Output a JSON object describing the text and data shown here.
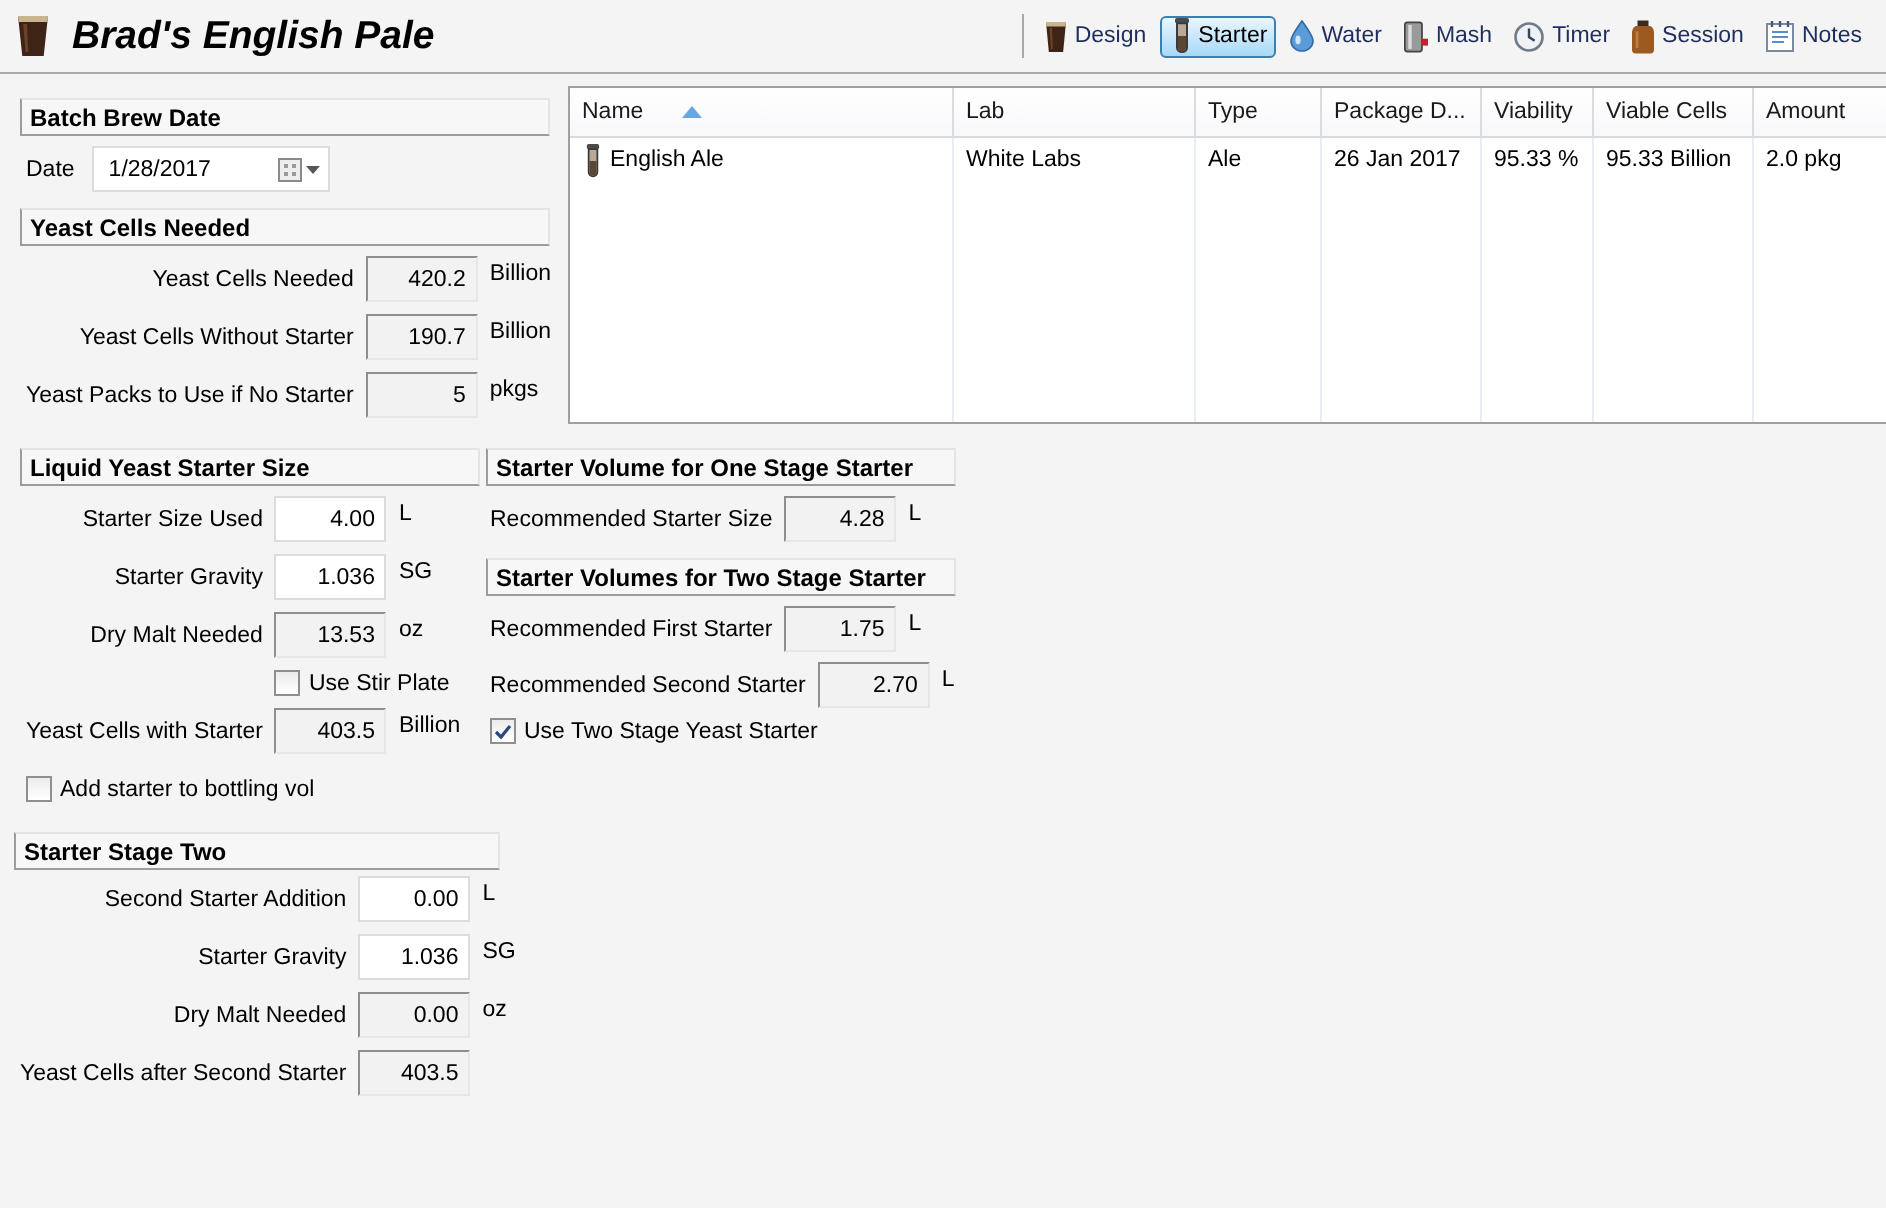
{
  "header": {
    "title": "Brad's English Pale",
    "toolbar": [
      {
        "label": "Design",
        "selected": false
      },
      {
        "label": "Starter",
        "selected": true
      },
      {
        "label": "Water",
        "selected": false
      },
      {
        "label": "Mash",
        "selected": false
      },
      {
        "label": "Timer",
        "selected": false
      },
      {
        "label": "Session",
        "selected": false
      },
      {
        "label": "Notes",
        "selected": false
      }
    ]
  },
  "batch_brew_date": {
    "heading": "Batch Brew Date",
    "date": {
      "label": "Date",
      "value": "1/28/2017"
    }
  },
  "yeast_cells_needed": {
    "heading": "Yeast Cells Needed",
    "items": [
      {
        "kind": "field",
        "label": "Yeast Cells Needed",
        "value": "420.2",
        "unit": "Billion",
        "readonly": true
      },
      {
        "kind": "field",
        "label": "Yeast Cells Without Starter",
        "value": "190.7",
        "unit": "Billion",
        "readonly": true
      },
      {
        "kind": "field",
        "label": "Yeast Packs to Use if No Starter",
        "value": "5",
        "unit": "pkgs",
        "readonly": true
      }
    ]
  },
  "yeast_table": {
    "columns": [
      {
        "label": "Name",
        "sorted": true
      },
      {
        "label": "Lab",
        "sorted": false
      },
      {
        "label": "Type",
        "sorted": false
      },
      {
        "label": "Package D...",
        "sorted": false
      },
      {
        "label": "Viability",
        "sorted": false
      },
      {
        "label": "Viable Cells",
        "sorted": false
      },
      {
        "label": "Amount",
        "sorted": false
      }
    ],
    "rows": [
      {
        "cells": [
          "English Ale",
          "White Labs",
          "Ale",
          "26 Jan 2017",
          "95.33 %",
          "95.33 Billion",
          "2.0 pkg"
        ]
      }
    ]
  },
  "liquid_yeast_starter_size": {
    "heading": "Liquid Yeast Starter Size",
    "items": [
      {
        "kind": "field",
        "label": "Starter Size Used",
        "value": "4.00",
        "unit": "L",
        "readonly": false
      },
      {
        "kind": "field",
        "label": "Starter Gravity",
        "value": "1.036",
        "unit": "SG",
        "readonly": false
      },
      {
        "kind": "field",
        "label": "Dry Malt Needed",
        "value": "13.53",
        "unit": "oz",
        "readonly": true
      },
      {
        "kind": "checkbox",
        "label": "Use Stir Plate",
        "checked": false
      },
      {
        "kind": "field",
        "label": "Yeast Cells with Starter",
        "value": "403.5",
        "unit": "Billion",
        "readonly": true
      }
    ],
    "bottling_option": {
      "label": "Add starter to bottling vol",
      "checked": false
    }
  },
  "one_stage_starter": {
    "heading": "Starter Volume for One Stage Starter",
    "items": [
      {
        "kind": "field",
        "label": "Recommended Starter Size",
        "value": "4.28",
        "unit": "L",
        "readonly": true
      }
    ]
  },
  "two_stage_starter": {
    "heading": "Starter Volumes for Two Stage Starter",
    "items": [
      {
        "kind": "field",
        "label": "Recommended First Starter",
        "value": "1.75",
        "unit": "L",
        "readonly": true
      },
      {
        "kind": "field",
        "label": "Recommended Second Starter",
        "value": "2.70",
        "unit": "L",
        "readonly": true
      },
      {
        "kind": "checkbox",
        "label": "Use Two Stage Yeast Starter",
        "checked": true
      }
    ]
  },
  "starter_stage_two": {
    "heading": "Starter Stage Two",
    "items": [
      {
        "kind": "field",
        "label": "Second Starter Addition",
        "value": "0.00",
        "unit": "L",
        "readonly": false
      },
      {
        "kind": "field",
        "label": "Starter Gravity",
        "value": "1.036",
        "unit": "SG",
        "readonly": false
      },
      {
        "kind": "field",
        "label": "Dry Malt Needed",
        "value": "0.00",
        "unit": "oz",
        "readonly": true
      },
      {
        "kind": "field",
        "label": "Yeast Cells after Second Starter",
        "value": "403.5",
        "readonly": true
      }
    ]
  }
}
